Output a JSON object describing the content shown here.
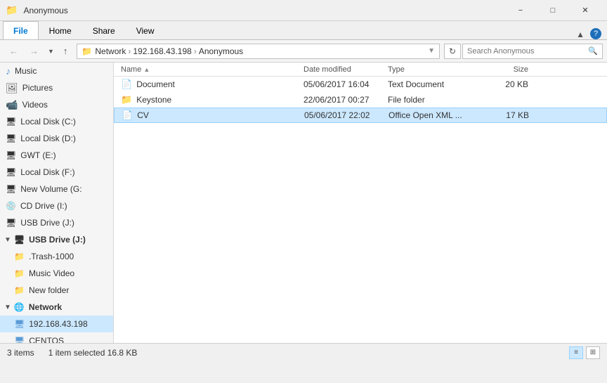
{
  "window": {
    "title": "Anonymous",
    "minimize_label": "−",
    "maximize_label": "□",
    "close_label": "✕"
  },
  "ribbon": {
    "tabs": [
      {
        "label": "File",
        "active": true
      },
      {
        "label": "Home",
        "active": false
      },
      {
        "label": "Share",
        "active": false
      },
      {
        "label": "View",
        "active": false
      }
    ]
  },
  "toolbar": {
    "back_label": "←",
    "forward_label": "→",
    "up_label": "↑",
    "recent_label": "▼"
  },
  "address_bar": {
    "path_items": [
      "Network",
      "192.168.43.198",
      "Anonymous"
    ],
    "refresh_icon": "↻",
    "search_placeholder": "Search Anonymous",
    "search_icon": "🔍"
  },
  "column_headers": {
    "name": "Name",
    "date_modified": "Date modified",
    "type": "Type",
    "size": "Size"
  },
  "files": [
    {
      "name": "Document",
      "date": "05/06/2017 16:04",
      "type": "Text Document",
      "size": "20 KB",
      "icon": "📄",
      "selected": false
    },
    {
      "name": "Keystone",
      "date": "22/06/2017 00:27",
      "type": "File folder",
      "size": "",
      "icon": "📁",
      "selected": false
    },
    {
      "name": "CV",
      "date": "05/06/2017 22:02",
      "type": "Office Open XML ...",
      "size": "17 KB",
      "icon": "📄",
      "selected": true
    }
  ],
  "sidebar": {
    "items": [
      {
        "label": "Music",
        "icon": "♪",
        "type": "item",
        "indent": 0
      },
      {
        "label": "Pictures",
        "icon": "🖼",
        "type": "item",
        "indent": 0
      },
      {
        "label": "Videos",
        "icon": "📹",
        "type": "item",
        "indent": 0
      },
      {
        "label": "Local Disk (C:)",
        "icon": "💾",
        "type": "item",
        "indent": 0
      },
      {
        "label": "Local Disk (D:)",
        "icon": "💾",
        "type": "item",
        "indent": 0
      },
      {
        "label": "GWT (E:)",
        "icon": "💾",
        "type": "item",
        "indent": 0
      },
      {
        "label": "Local Disk (F:)",
        "icon": "💾",
        "type": "item",
        "indent": 0
      },
      {
        "label": "New Volume (G:)",
        "icon": "💾",
        "type": "item",
        "indent": 0
      },
      {
        "label": "CD Drive (I:)",
        "icon": "💿",
        "type": "item",
        "indent": 0
      },
      {
        "label": "USB Drive (J:)",
        "icon": "💾",
        "type": "item",
        "indent": 0
      },
      {
        "label": "USB Drive (J:)",
        "icon": "💾",
        "type": "section",
        "indent": 0
      },
      {
        "label": ".Trash-1000",
        "icon": "📁",
        "type": "item",
        "indent": 1
      },
      {
        "label": "Music Video",
        "icon": "📁",
        "type": "item",
        "indent": 1
      },
      {
        "label": "New folder",
        "icon": "📁",
        "type": "item",
        "indent": 1
      },
      {
        "label": "Network",
        "icon": "🌐",
        "type": "section",
        "indent": 0
      },
      {
        "label": "192.168.43.198",
        "icon": "🖥",
        "type": "item",
        "indent": 1,
        "selected": true
      },
      {
        "label": "CENTOS",
        "icon": "🖥",
        "type": "item",
        "indent": 1
      }
    ]
  },
  "status_bar": {
    "item_count": "3 items",
    "selected_info": "1 item selected  16.8 KB"
  }
}
